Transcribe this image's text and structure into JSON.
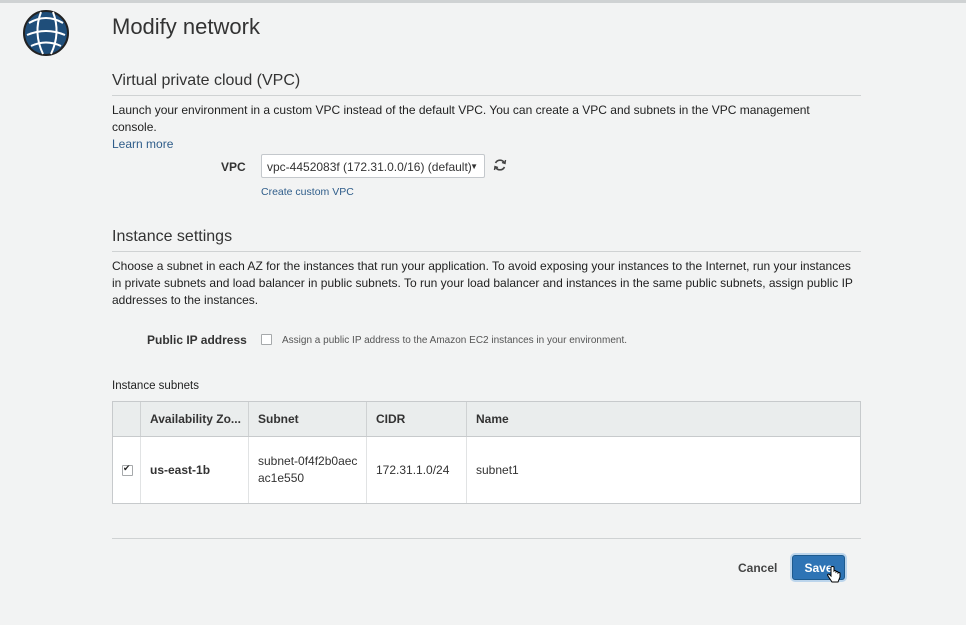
{
  "page": {
    "title": "Modify network"
  },
  "vpc_section": {
    "heading": "Virtual private cloud (VPC)",
    "description": "Launch your environment in a custom VPC instead of the default VPC. You can create a VPC and subnets in the VPC management console.",
    "learn_more": "Learn more",
    "vpc_label": "VPC",
    "vpc_selected": "vpc-4452083f (172.31.0.0/16) (default)",
    "create_link": "Create custom VPC"
  },
  "instance_section": {
    "heading": "Instance settings",
    "description": "Choose a subnet in each AZ for the instances that run your application. To avoid exposing your instances to the Internet, run your instances in private subnets and load balancer in public subnets. To run your load balancer and instances in the same public subnets, assign public IP addresses to the instances.",
    "public_ip_label": "Public IP address",
    "public_ip_checked": false,
    "public_ip_hint": "Assign a public IP address to the Amazon EC2 instances in your environment.",
    "subnets_label": "Instance subnets"
  },
  "subnet_table": {
    "columns": [
      "Availability Zo...",
      "Subnet",
      "CIDR",
      "Name"
    ],
    "rows": [
      {
        "checked": true,
        "az": "us-east-1b",
        "subnet": "subnet-0f4f2b0aecac1e550",
        "cidr": "172.31.1.0/24",
        "name": "subnet1"
      }
    ]
  },
  "footer": {
    "cancel_label": "Cancel",
    "save_label": "Save"
  }
}
